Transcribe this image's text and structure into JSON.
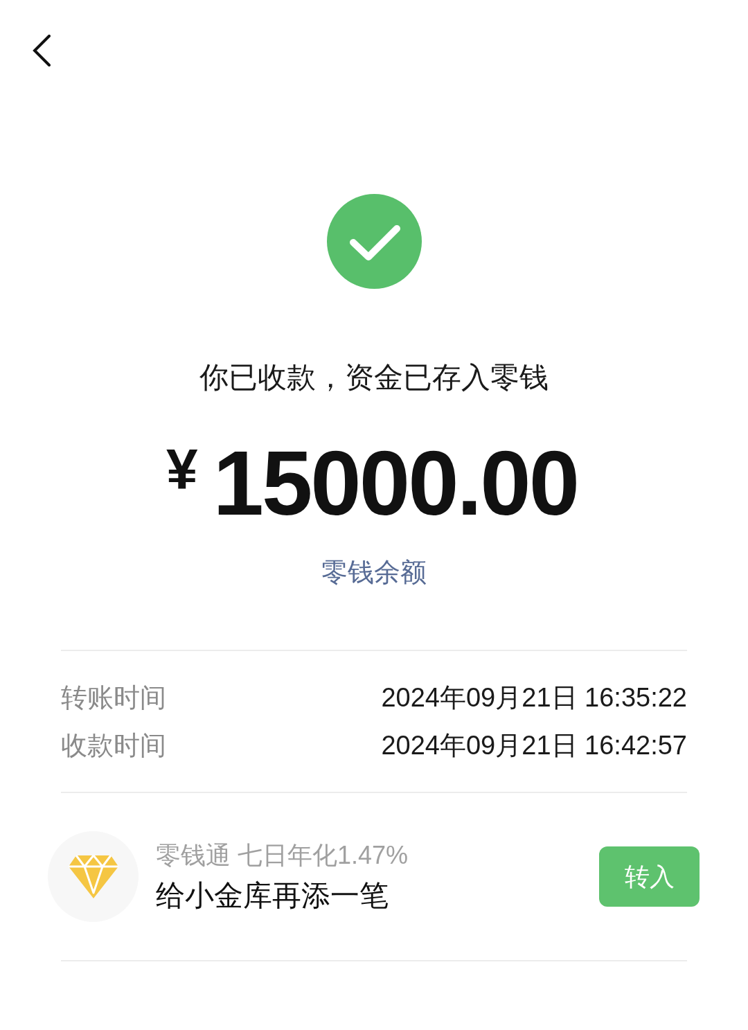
{
  "status": {
    "message": "你已收款，资金已存入零钱",
    "currency": "¥",
    "amount": "15000.00",
    "link": "零钱余额"
  },
  "details": [
    {
      "label": "转账时间",
      "value": "2024年09月21日 16:35:22"
    },
    {
      "label": "收款时间",
      "value": "2024年09月21日 16:42:57"
    }
  ],
  "promo": {
    "subtitle": "零钱通 七日年化1.47%",
    "title": "给小金库再添一笔",
    "button": "转入"
  }
}
